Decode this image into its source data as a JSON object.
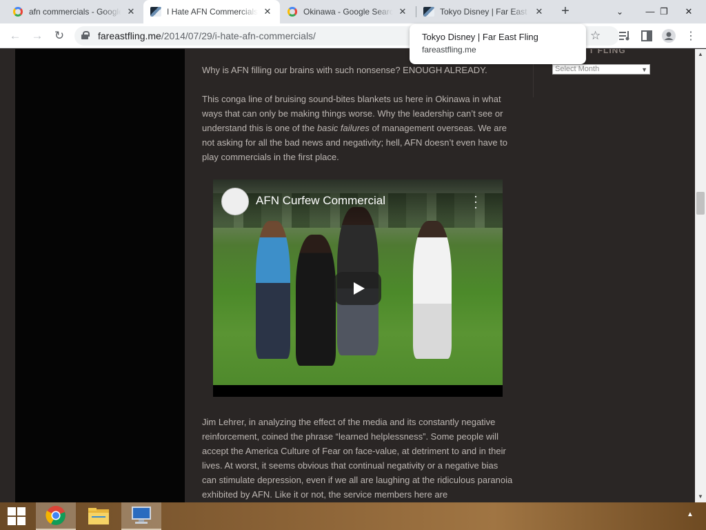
{
  "browser": {
    "tabs": [
      {
        "title": "afn commercials - Google Search",
        "favicon": "google-g-icon"
      },
      {
        "title": "I Hate AFN Commercials | Far East Fling",
        "favicon": "site-favicon-icon"
      },
      {
        "title": "Okinawa - Google Search",
        "favicon": "google-g-icon"
      },
      {
        "title": "Tokyo Disney | Far East Fling",
        "favicon": "site-favicon-icon"
      }
    ],
    "new_tab_label": "+",
    "url_host": "fareastfling.me",
    "url_path": "/2014/07/29/i-hate-afn-commercials/",
    "hover_card": {
      "title": "Tokyo Disney | Far East Fling",
      "domain": "fareastfling.me"
    }
  },
  "article": {
    "p1": "Why is AFN filling our brains with such nonsense?  ENOUGH ALREADY.",
    "p2_before": "This conga line of bruising sound-bites blankets us here in Okinawa in what ways that can only be making things worse.  Why the leadership can’t see or understand this is one of the ",
    "p2_em": "basic failures",
    "p2_after": " of management overseas.  We are not asking for all the bad news and negativity; hell, AFN doesn’t even have to play commercials in the first place.",
    "p3": "Jim Lehrer, in analyzing the effect of the media and its constantly negative reinforcement, coined the phrase “learned helplessness”.  Some people will accept the America Culture of Fear on face-value, at detriment to and in their lives.  At worst, it seems obvious that continual negativity or a negative bias can stimulate depression, even if we all are laughing at the ridiculous paranoia exhibited by AFN.  Like it or not, the service members here are"
  },
  "video": {
    "title": "AFN Curfew Commercial"
  },
  "sidebar": {
    "title_fragment": "T FLING",
    "archive_select_value": "Select Month"
  },
  "taskbar": {
    "apps": [
      "chrome-icon",
      "file-explorer-icon",
      "remote-desktop-icon"
    ]
  }
}
